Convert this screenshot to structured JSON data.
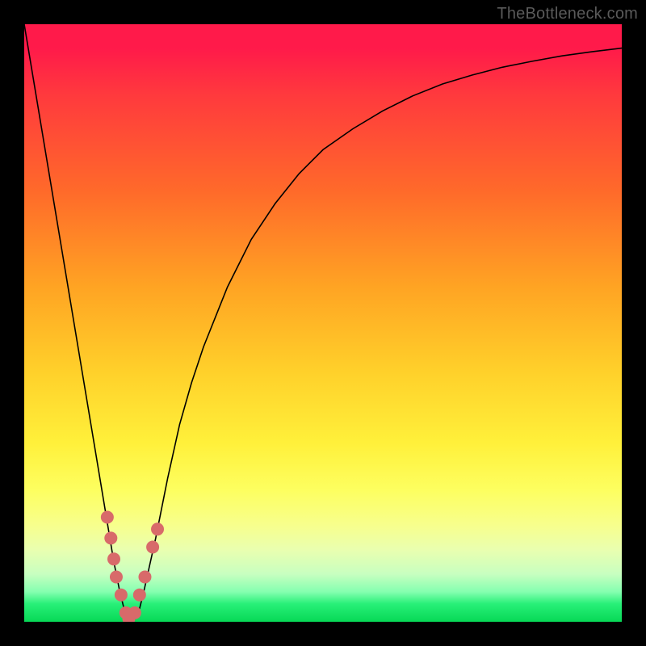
{
  "watermark": "TheBottleneck.com",
  "chart_data": {
    "type": "line",
    "title": "",
    "xlabel": "",
    "ylabel": "",
    "xlim": [
      0,
      100
    ],
    "ylim": [
      0,
      100
    ],
    "grid": false,
    "series": [
      {
        "name": "bottleneck-curve",
        "color": "#000000",
        "x": [
          0,
          2,
          4,
          6,
          8,
          10,
          12,
          14,
          15,
          16,
          17,
          18,
          19,
          20,
          22,
          24,
          26,
          28,
          30,
          34,
          38,
          42,
          46,
          50,
          55,
          60,
          65,
          70,
          75,
          80,
          85,
          90,
          95,
          100
        ],
        "y": [
          100,
          88,
          76,
          64,
          52,
          40,
          28,
          16,
          10,
          5,
          1,
          0,
          1,
          5,
          14,
          24,
          33,
          40,
          46,
          56,
          64,
          70,
          75,
          79,
          82.5,
          85.5,
          88,
          90,
          91.5,
          92.8,
          93.8,
          94.7,
          95.4,
          96
        ]
      }
    ],
    "markers": {
      "name": "highlight-cluster",
      "color": "#d86a6a",
      "points": [
        {
          "x": 13.9,
          "y": 17.5
        },
        {
          "x": 14.5,
          "y": 14
        },
        {
          "x": 15.0,
          "y": 10.5
        },
        {
          "x": 15.4,
          "y": 7.5
        },
        {
          "x": 16.2,
          "y": 4.5
        },
        {
          "x": 17.0,
          "y": 1.5
        },
        {
          "x": 17.5,
          "y": 0.5
        },
        {
          "x": 18.5,
          "y": 1.5
        },
        {
          "x": 19.3,
          "y": 4.5
        },
        {
          "x": 20.2,
          "y": 7.5
        },
        {
          "x": 21.5,
          "y": 12.5
        },
        {
          "x": 22.3,
          "y": 15.5
        }
      ]
    },
    "gradient_stops": [
      {
        "pos": 0,
        "color": "#ff1a4a"
      },
      {
        "pos": 100,
        "color": "#07d856"
      }
    ]
  }
}
